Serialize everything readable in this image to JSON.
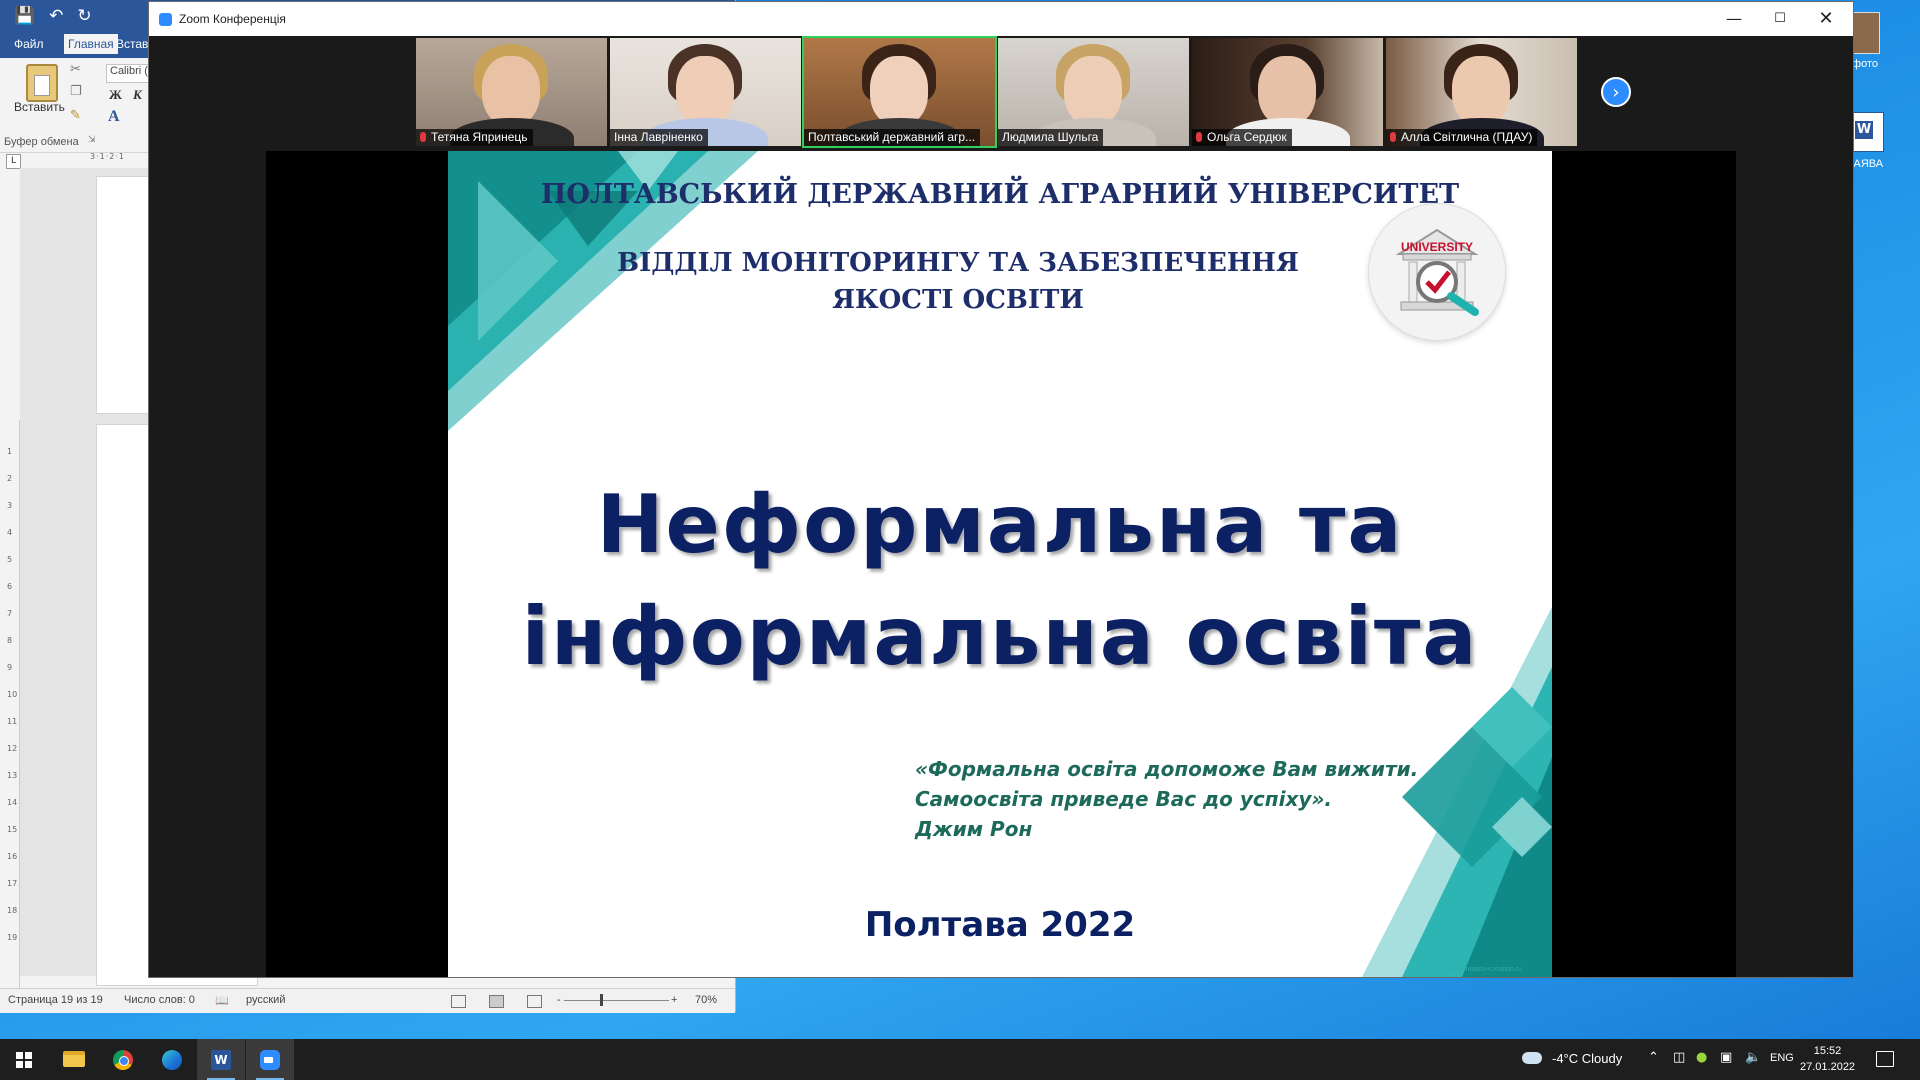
{
  "word": {
    "tabs": [
      "Файл",
      "Главная",
      "Вставка"
    ],
    "paste_label": "Вставить",
    "font_name": "Calibri (",
    "bold": "Ж",
    "italic": "К",
    "clipboard_group": "Буфер обмена",
    "status": {
      "page": "Страница 19 из 19",
      "words": "Число слов: 0",
      "language": "русский",
      "zoom": "70%"
    }
  },
  "desktop": {
    "icons": [
      "фото",
      "ЗАЯВА"
    ]
  },
  "zoom": {
    "window_title": "Zoom Конференція",
    "participants": [
      {
        "name": "Тетяна Япринець",
        "muted": true
      },
      {
        "name": "Інна Лавріненко",
        "muted": false
      },
      {
        "name": "Полтавський державний агр...",
        "muted": false,
        "speaking": true
      },
      {
        "name": "Людмила Шульга",
        "muted": false
      },
      {
        "name": "Ольга Сердюк",
        "muted": true
      },
      {
        "name": "Алла Світлична (ПДАУ)",
        "muted": true
      }
    ]
  },
  "slide": {
    "university": "ПОЛТАВСЬКИЙ  ДЕРЖАВНИЙ АГРАРНИЙ УНІВЕРСИТЕТ",
    "department_line1": "ВІДДІЛ МОНІТОРИНГУ  ТА ЗАБЕЗПЕЧЕННЯ",
    "department_line2": "ЯКОСТІ ОСВІТИ",
    "logo_text": "UNIVERSITY",
    "title_line1": "Неформальна та",
    "title_line2": "інформальна освіта",
    "quote_line1": "«Формальна освіта допоможе Вам вижити.",
    "quote_line2": "Самоосвіта приведе Вас до успіху».",
    "quote_author": "Джим Рон",
    "city_year": "Полтава 2022",
    "watermark": "presentation-creation.ru"
  },
  "taskbar": {
    "weather": "-4°C  Cloudy",
    "language": "ENG",
    "time": "15:52",
    "date": "27.01.2022"
  },
  "colors": {
    "slide_navy": "#0c2064",
    "teal": "#1fb3b0",
    "zoom_blue": "#2d8cff",
    "word_blue": "#2b579a"
  }
}
